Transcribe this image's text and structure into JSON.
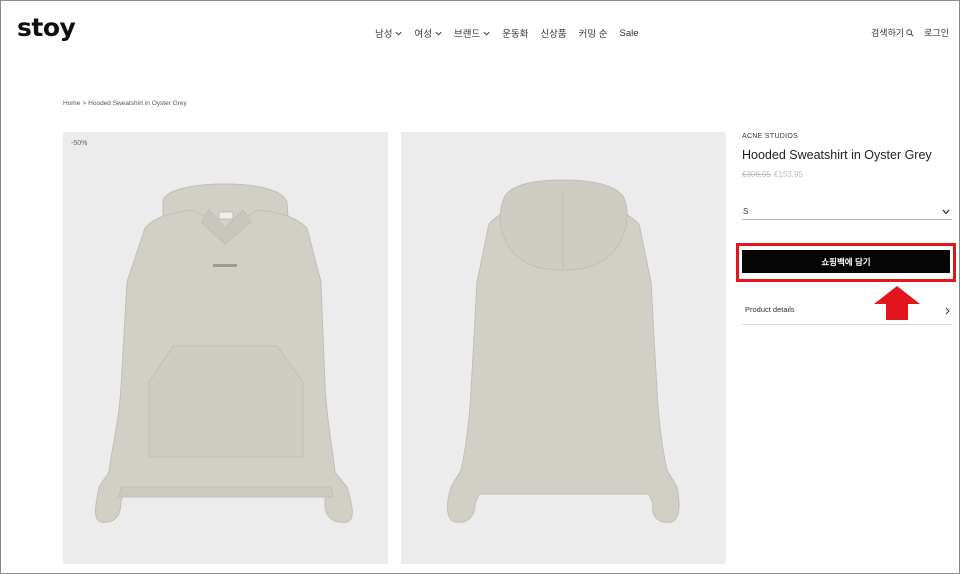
{
  "header": {
    "logo": "stoy",
    "nav": [
      {
        "label": "남성",
        "has_dropdown": true
      },
      {
        "label": "여성",
        "has_dropdown": true
      },
      {
        "label": "브랜드",
        "has_dropdown": true
      },
      {
        "label": "운동화",
        "has_dropdown": false
      },
      {
        "label": "신상품",
        "has_dropdown": false
      },
      {
        "label": "커밍 순",
        "has_dropdown": false
      },
      {
        "label": "Sale",
        "has_dropdown": false
      }
    ],
    "search_label": "검색하기",
    "login_label": "로그인"
  },
  "breadcrumb": {
    "home": "Home",
    "separator": ">",
    "current": "Hooded Sweatshirt in Oyster Grey"
  },
  "gallery": {
    "discount_badge": "-50%",
    "images": [
      "hoodie-front-image",
      "hoodie-back-image"
    ],
    "product_color": "#d2cfc6",
    "background_color": "#ececec"
  },
  "product": {
    "brand": "ACNE STUDIOS",
    "title": "Hooded Sweatshirt in Oyster Grey",
    "original_price": "€306,95",
    "sale_price": "€153,95",
    "selected_size": "S",
    "add_to_cart": "쇼핑백에 담기",
    "details_label": "Product details"
  },
  "annotation": {
    "highlight_color": "#e2141d",
    "arrow_icon": "up-arrow-icon"
  }
}
